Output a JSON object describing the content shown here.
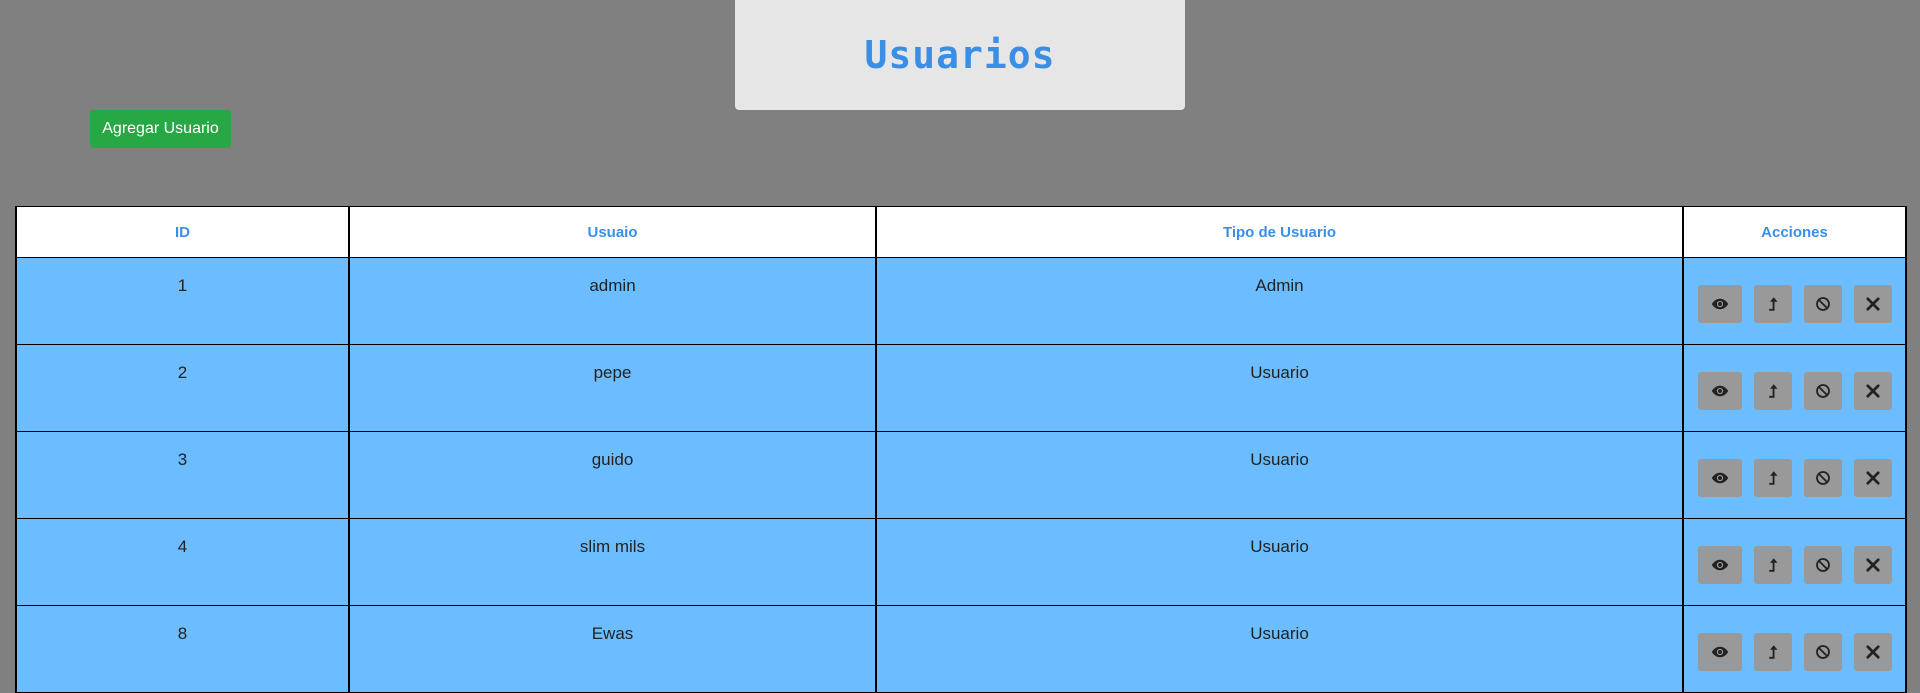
{
  "header": {
    "title": "Usuarios"
  },
  "toolbar": {
    "add_label": "Agregar Usuario"
  },
  "table": {
    "columns": [
      "ID",
      "Usuaio",
      "Tipo de Usuario",
      "Acciones"
    ],
    "rows": [
      {
        "id": "1",
        "user": "admin",
        "type": "Admin"
      },
      {
        "id": "2",
        "user": "pepe",
        "type": "Usuario"
      },
      {
        "id": "3",
        "user": "guido",
        "type": "Usuario"
      },
      {
        "id": "4",
        "user": "slim mils",
        "type": "Usuario"
      },
      {
        "id": "8",
        "user": "Ewas",
        "type": "Usuario"
      }
    ],
    "actions": [
      "eye-icon",
      "level-up-icon",
      "ban-icon",
      "times-icon"
    ]
  },
  "colors": {
    "background": "#808080",
    "accent": "#3a8ee6",
    "row": "#6bbdff",
    "add_button": "#28a745",
    "action_button": "#999999"
  }
}
